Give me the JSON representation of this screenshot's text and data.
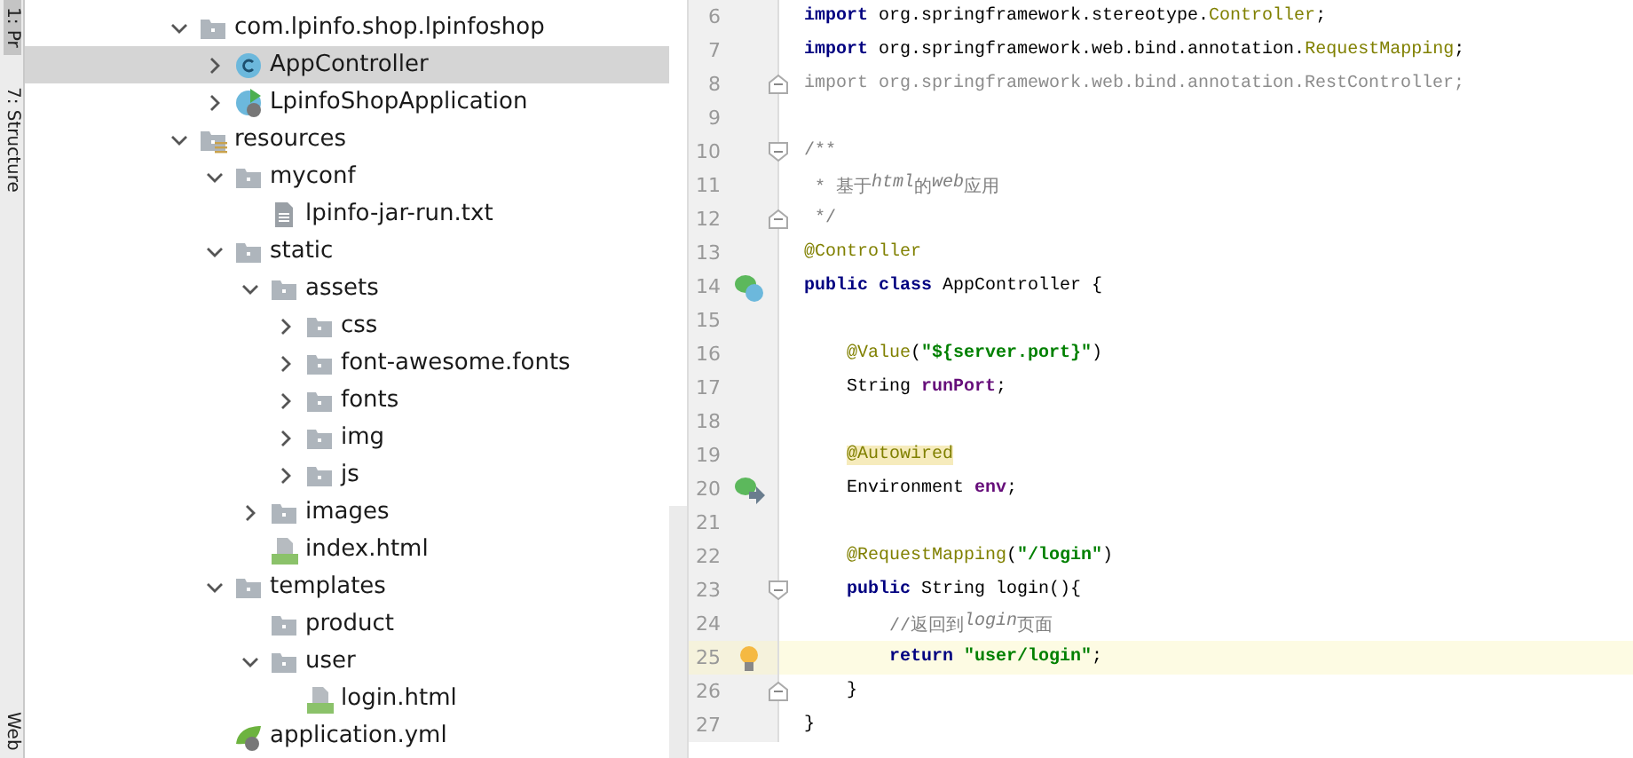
{
  "tool_tabs": [
    {
      "label": "1: Pr",
      "selected": true
    },
    {
      "label": "7: Structure",
      "selected": false
    },
    {
      "label": "Web",
      "selected": false
    }
  ],
  "tree": [
    {
      "label": "com.lpinfo.shop.lpinfoshop",
      "kind": "package",
      "expanded": true,
      "selected": false,
      "children": [
        {
          "label": "AppController",
          "kind": "class",
          "expanded": false,
          "selected": true
        },
        {
          "label": "LpinfoShopApplication",
          "kind": "app-class",
          "expanded": false,
          "selected": false
        }
      ]
    },
    {
      "label": "resources",
      "kind": "resources",
      "expanded": true,
      "selected": false,
      "children": [
        {
          "label": "myconf",
          "kind": "folder",
          "expanded": true,
          "selected": false,
          "children": [
            {
              "label": "lpinfo-jar-run.txt",
              "kind": "text-file",
              "selected": false
            }
          ]
        },
        {
          "label": "static",
          "kind": "folder",
          "expanded": true,
          "selected": false,
          "children": [
            {
              "label": "assets",
              "kind": "folder",
              "expanded": true,
              "selected": false,
              "children": [
                {
                  "label": "css",
                  "kind": "folder",
                  "expanded": false,
                  "selected": false
                },
                {
                  "label": "font-awesome.fonts",
                  "kind": "folder",
                  "expanded": false,
                  "selected": false
                },
                {
                  "label": "fonts",
                  "kind": "folder",
                  "expanded": false,
                  "selected": false
                },
                {
                  "label": "img",
                  "kind": "folder",
                  "expanded": false,
                  "selected": false
                },
                {
                  "label": "js",
                  "kind": "folder",
                  "expanded": false,
                  "selected": false
                }
              ]
            },
            {
              "label": "images",
              "kind": "folder",
              "expanded": false,
              "selected": false
            },
            {
              "label": "index.html",
              "kind": "html-file",
              "selected": false
            }
          ]
        },
        {
          "label": "templates",
          "kind": "folder",
          "expanded": true,
          "selected": false,
          "children": [
            {
              "label": "product",
              "kind": "empty-folder",
              "selected": false
            },
            {
              "label": "user",
              "kind": "folder",
              "expanded": true,
              "selected": false,
              "children": [
                {
                  "label": "login.html",
                  "kind": "html-file",
                  "selected": false
                }
              ]
            }
          ]
        },
        {
          "label": "application.yml",
          "kind": "yml-file",
          "selected": false
        }
      ]
    }
  ],
  "editor": {
    "lines": [
      {
        "number": "6",
        "tokens": [
          {
            "kind": "keyword",
            "text": "import"
          },
          {
            "kind": "plain",
            "text": " org.springframework.stereotype."
          },
          {
            "kind": "type",
            "text": "Controller"
          },
          {
            "kind": "plain",
            "text": ";"
          }
        ]
      },
      {
        "number": "7",
        "tokens": [
          {
            "kind": "keyword",
            "text": "import"
          },
          {
            "kind": "plain",
            "text": " org.springframework.web.bind.annotation."
          },
          {
            "kind": "type",
            "text": "RequestMapping"
          },
          {
            "kind": "plain",
            "text": ";"
          }
        ]
      },
      {
        "number": "8",
        "fold": {
          "kind": "end"
        },
        "tokens": [
          {
            "kind": "unused",
            "text": "import org.springframework.web.bind.annotation.RestController;"
          }
        ]
      },
      {
        "number": "9"
      },
      {
        "number": "10",
        "fold": {
          "kind": "start"
        },
        "tokens": [
          {
            "kind": "comment",
            "text": "/**"
          }
        ]
      },
      {
        "number": "11",
        "tokens": [
          {
            "kind": "comment",
            "text": " * 基于"
          },
          {
            "kind": "comment-italic",
            "text": "html"
          },
          {
            "kind": "comment",
            "text": "的"
          },
          {
            "kind": "comment-italic",
            "text": "web"
          },
          {
            "kind": "comment",
            "text": "应用"
          }
        ]
      },
      {
        "number": "12",
        "fold": {
          "kind": "end"
        },
        "tokens": [
          {
            "kind": "comment",
            "text": " */"
          }
        ]
      },
      {
        "number": "13",
        "tokens": [
          {
            "kind": "annotation",
            "text": "@Controller"
          }
        ]
      },
      {
        "number": "14",
        "gutter": {
          "kind": "bean-class"
        },
        "tokens": [
          {
            "kind": "keyword",
            "text": "public class"
          },
          {
            "kind": "plain",
            "text": " AppController {"
          }
        ]
      },
      {
        "number": "15"
      },
      {
        "number": "16",
        "kind": "member",
        "tokens": [
          {
            "kind": "annotation",
            "text": "@Value"
          },
          {
            "kind": "plain",
            "text": "("
          },
          {
            "kind": "string",
            "text": "\"${server.port}\""
          },
          {
            "kind": "plain",
            "text": ")"
          }
        ]
      },
      {
        "number": "17",
        "kind": "member",
        "tokens": [
          {
            "kind": "plain",
            "text": "String "
          },
          {
            "kind": "field",
            "text": "runPort"
          },
          {
            "kind": "plain",
            "text": ";"
          }
        ]
      },
      {
        "number": "18"
      },
      {
        "number": "19",
        "kind": "member",
        "tokens": [
          {
            "kind": "highlighted-annotation",
            "text": "@Autowired"
          }
        ]
      },
      {
        "number": "20",
        "kind": "member",
        "gutter": {
          "kind": "bean-link"
        },
        "tokens": [
          {
            "kind": "plain",
            "text": "Environment "
          },
          {
            "kind": "field",
            "text": "env"
          },
          {
            "kind": "plain",
            "text": ";"
          }
        ]
      },
      {
        "number": "21"
      },
      {
        "number": "22",
        "kind": "member",
        "tokens": [
          {
            "kind": "annotation",
            "text": "@RequestMapping"
          },
          {
            "kind": "plain",
            "text": "("
          },
          {
            "kind": "string",
            "text": "\"/login\""
          },
          {
            "kind": "plain",
            "text": ")"
          }
        ]
      },
      {
        "number": "23",
        "kind": "member",
        "fold": {
          "kind": "start"
        },
        "tokens": [
          {
            "kind": "keyword",
            "text": "public"
          },
          {
            "kind": "plain",
            "text": " String login(){"
          }
        ]
      },
      {
        "number": "24",
        "kind": "statement",
        "tokens": [
          {
            "kind": "comment",
            "text": "//返回到"
          },
          {
            "kind": "comment-italic",
            "text": "login"
          },
          {
            "kind": "comment",
            "text": "页面"
          }
        ]
      },
      {
        "number": "25",
        "kind": "statement",
        "current": true,
        "gutter": {
          "kind": "bulb"
        },
        "tokens": [
          {
            "kind": "keyword",
            "text": "return"
          },
          {
            "kind": "string",
            "text": " \"user/login\""
          },
          {
            "kind": "plain",
            "text": ";"
          }
        ]
      },
      {
        "number": "26",
        "kind": "member",
        "fold": {
          "kind": "end"
        },
        "tokens": [
          {
            "kind": "plain",
            "text": "}"
          }
        ]
      },
      {
        "number": "27",
        "tokens": [
          {
            "kind": "plain",
            "text": "}"
          }
        ]
      }
    ]
  }
}
